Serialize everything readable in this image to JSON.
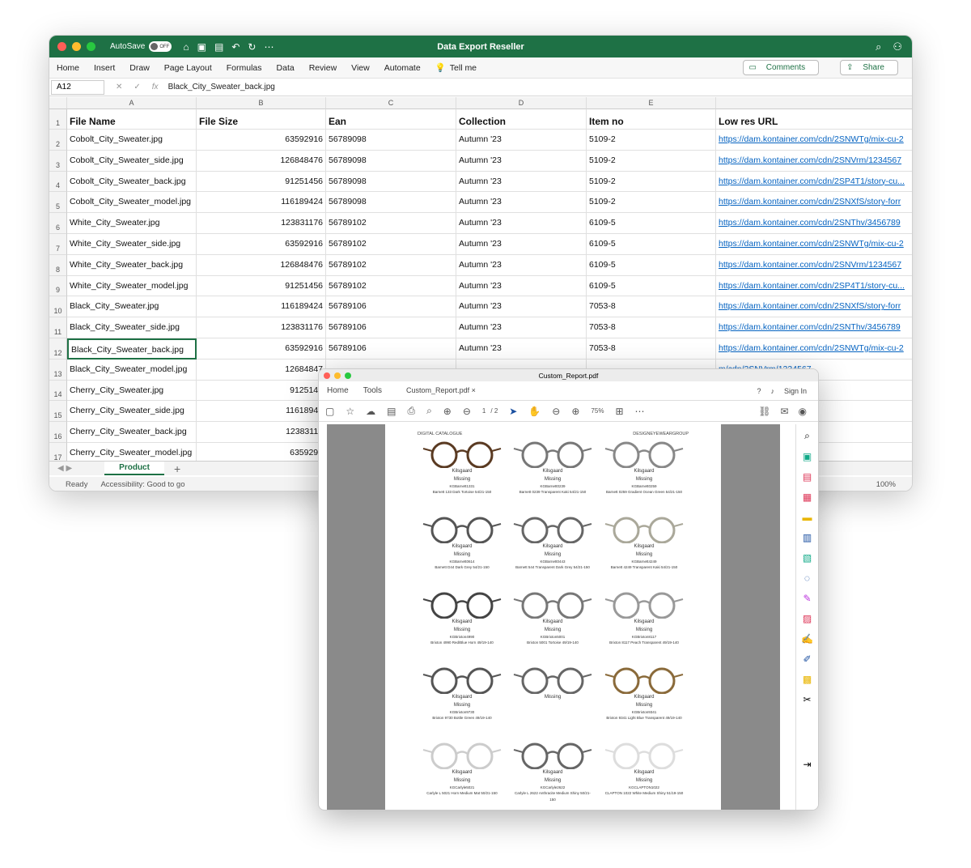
{
  "excel": {
    "autosave": "AutoSave",
    "autosave_state": "OFF",
    "title": "Data Export Reseller",
    "menu": [
      "Home",
      "Insert",
      "Draw",
      "Page Layout",
      "Formulas",
      "Data",
      "Review",
      "View",
      "Automate",
      "Tell me"
    ],
    "comments": "Comments",
    "share": "Share",
    "name_box": "A12",
    "formula": "Black_City_Sweater_back.jpg",
    "columns": [
      "A",
      "B",
      "C",
      "D",
      "E"
    ],
    "headers": [
      "File Name",
      "File Size",
      "Ean",
      "Collection",
      "Item no",
      "Low res URL"
    ],
    "rows": [
      [
        "Cobolt_City_Sweater.jpg",
        "63592916",
        "56789098",
        "Autumn '23",
        "5109-2",
        "https://dam.kontainer.com/cdn/2SNWTg/mix-cu-2"
      ],
      [
        "Cobolt_City_Sweater_side.jpg",
        "126848476",
        "56789098",
        "Autumn '23",
        "5109-2",
        "https://dam.kontainer.com/cdn/2SNVrm/1234567"
      ],
      [
        "Cobolt_City_Sweater_back.jpg",
        "91251456",
        "56789098",
        "Autumn '23",
        "5109-2",
        "https://dam.kontainer.com/cdn/2SP4T1/story-cu..."
      ],
      [
        "Cobolt_City_Sweater_model.jpg",
        "116189424",
        "56789098",
        "Autumn '23",
        "5109-2",
        "https://dam.kontainer.com/cdn/2SNXfS/story-forr"
      ],
      [
        "White_City_Sweater.jpg",
        "123831176",
        "56789102",
        "Autumn '23",
        "6109-5",
        "https://dam.kontainer.com/cdn/2SNThv/3456789"
      ],
      [
        "White_City_Sweater_side.jpg",
        "63592916",
        "56789102",
        "Autumn '23",
        "6109-5",
        "https://dam.kontainer.com/cdn/2SNWTg/mix-cu-2"
      ],
      [
        "White_City_Sweater_back.jpg",
        "126848476",
        "56789102",
        "Autumn '23",
        "6109-5",
        "https://dam.kontainer.com/cdn/2SNVrm/1234567"
      ],
      [
        "White_City_Sweater_model.jpg",
        "91251456",
        "56789102",
        "Autumn '23",
        "6109-5",
        "https://dam.kontainer.com/cdn/2SP4T1/story-cu..."
      ],
      [
        "Black_City_Sweater.jpg",
        "116189424",
        "56789106",
        "Autumn '23",
        "7053-8",
        "https://dam.kontainer.com/cdn/2SNXfS/story-forr"
      ],
      [
        "Black_City_Sweater_side.jpg",
        "123831176",
        "56789106",
        "Autumn '23",
        "7053-8",
        "https://dam.kontainer.com/cdn/2SNThv/3456789"
      ],
      [
        "Black_City_Sweater_back.jpg",
        "63592916",
        "56789106",
        "Autumn '23",
        "7053-8",
        "https://dam.kontainer.com/cdn/2SNWTg/mix-cu-2"
      ],
      [
        "Black_City_Sweater_model.jpg",
        "12684847",
        "",
        "",
        "",
        "m/cdn/2SNVrm/1234567"
      ],
      [
        "Cherry_City_Sweater.jpg",
        "9125145",
        "",
        "",
        "",
        "m/cdn/2SP4T1/story-cu..."
      ],
      [
        "Cherry_City_Sweater_side.jpg",
        "11618942",
        "",
        "",
        "",
        "m/cdn/2SNXfS/story-forr"
      ],
      [
        "Cherry_City_Sweater_back.jpg",
        "12383117",
        "",
        "",
        "",
        "m/cdn/2SNThv/3456789"
      ],
      [
        "Cherry_City_Sweater_model.jpg",
        "6359291",
        "",
        "",
        "",
        "m/cdn/2SNWTg/mix-cu-2"
      ]
    ],
    "sheet": "Product",
    "status": "Ready",
    "accessibility": "Accessibility: Good to go",
    "zoom": "100%"
  },
  "pdf": {
    "title": "Custom_Report.pdf",
    "tabs": [
      "Home",
      "Tools"
    ],
    "tab_doc": "Custom_Report.pdf",
    "sign_in": "Sign In",
    "page": "1",
    "pages": "/ 2",
    "zoom": "75%",
    "page_header_left": "DIGITAL CATALOGUE",
    "page_header_right": "DESIGNEYEWEARGROUP",
    "frames": [
      [
        "Kilsgaard",
        "Missing",
        "KGBarnett1331",
        "Barnett 133 Dark Tortoise 54/21-150",
        "#5a3a22"
      ],
      [
        "Kilsgaard",
        "Missing",
        "KGBarnett0239",
        "Barnett 0239 Transparent Kaki 54/21-150",
        "#777"
      ],
      [
        "Kilsgaard",
        "Missing",
        "KGBarnett0259",
        "Barnett 0259 Gradient Ocean Green 54/21-150",
        "#888"
      ],
      [
        "Kilsgaard",
        "Missing",
        "KGBarnett0614",
        "Barnett D44 Dark Grey 54/21-150",
        "#555"
      ],
      [
        "Kilsgaard",
        "Missing",
        "KGBarnett0443",
        "Barnett 544 Transparent Dark Grey 54/21-150",
        "#666"
      ],
      [
        "Kilsgaard",
        "Missing",
        "KGBarnett4249",
        "Barnett 4249 Transparent Kaki 54/21-150",
        "#aaa89a"
      ],
      [
        "Kilsgaard",
        "Missing",
        "KGBrixton4990",
        "Brixton 4990 Red/Blue Horn 49/19-140",
        "#444"
      ],
      [
        "Kilsgaard",
        "Missing",
        "KGBrixton5001",
        "Brixton 5001 Tortoise 49/19-140",
        "#777"
      ],
      [
        "Kilsgaard",
        "Missing",
        "KGBrixton8117",
        "Brixton 8117 Peach Transparent 49/19-140",
        "#999"
      ],
      [
        "Kilsgaard",
        "Missing",
        "KGBrixton9730",
        "Brixton 9730 Bottle Green 49/19-140",
        "#555"
      ],
      [
        "",
        "Missing",
        "",
        "",
        "#666"
      ],
      [
        "Kilsgaard",
        "Missing",
        "KGBrixton9341",
        "Brixton 9341 Light Blue Transparent 49/19-140",
        "#8a6a3a"
      ],
      [
        "Kilsgaard",
        "Missing",
        "KGCarlyle5021",
        "Carlyle L 5021 Horn Medium Mat 50/21-150",
        "#ccc"
      ],
      [
        "Kilsgaard",
        "Missing",
        "KGCarlyle2622",
        "Carlyle L 2622 Anthracite Medium Shiny 50/21-150",
        "#666"
      ],
      [
        "Kilsgaard",
        "Missing",
        "KGCLAPTON1022",
        "CLAPTON 1022 White Medium Shiny 51/19-150",
        "#ddd"
      ]
    ]
  }
}
